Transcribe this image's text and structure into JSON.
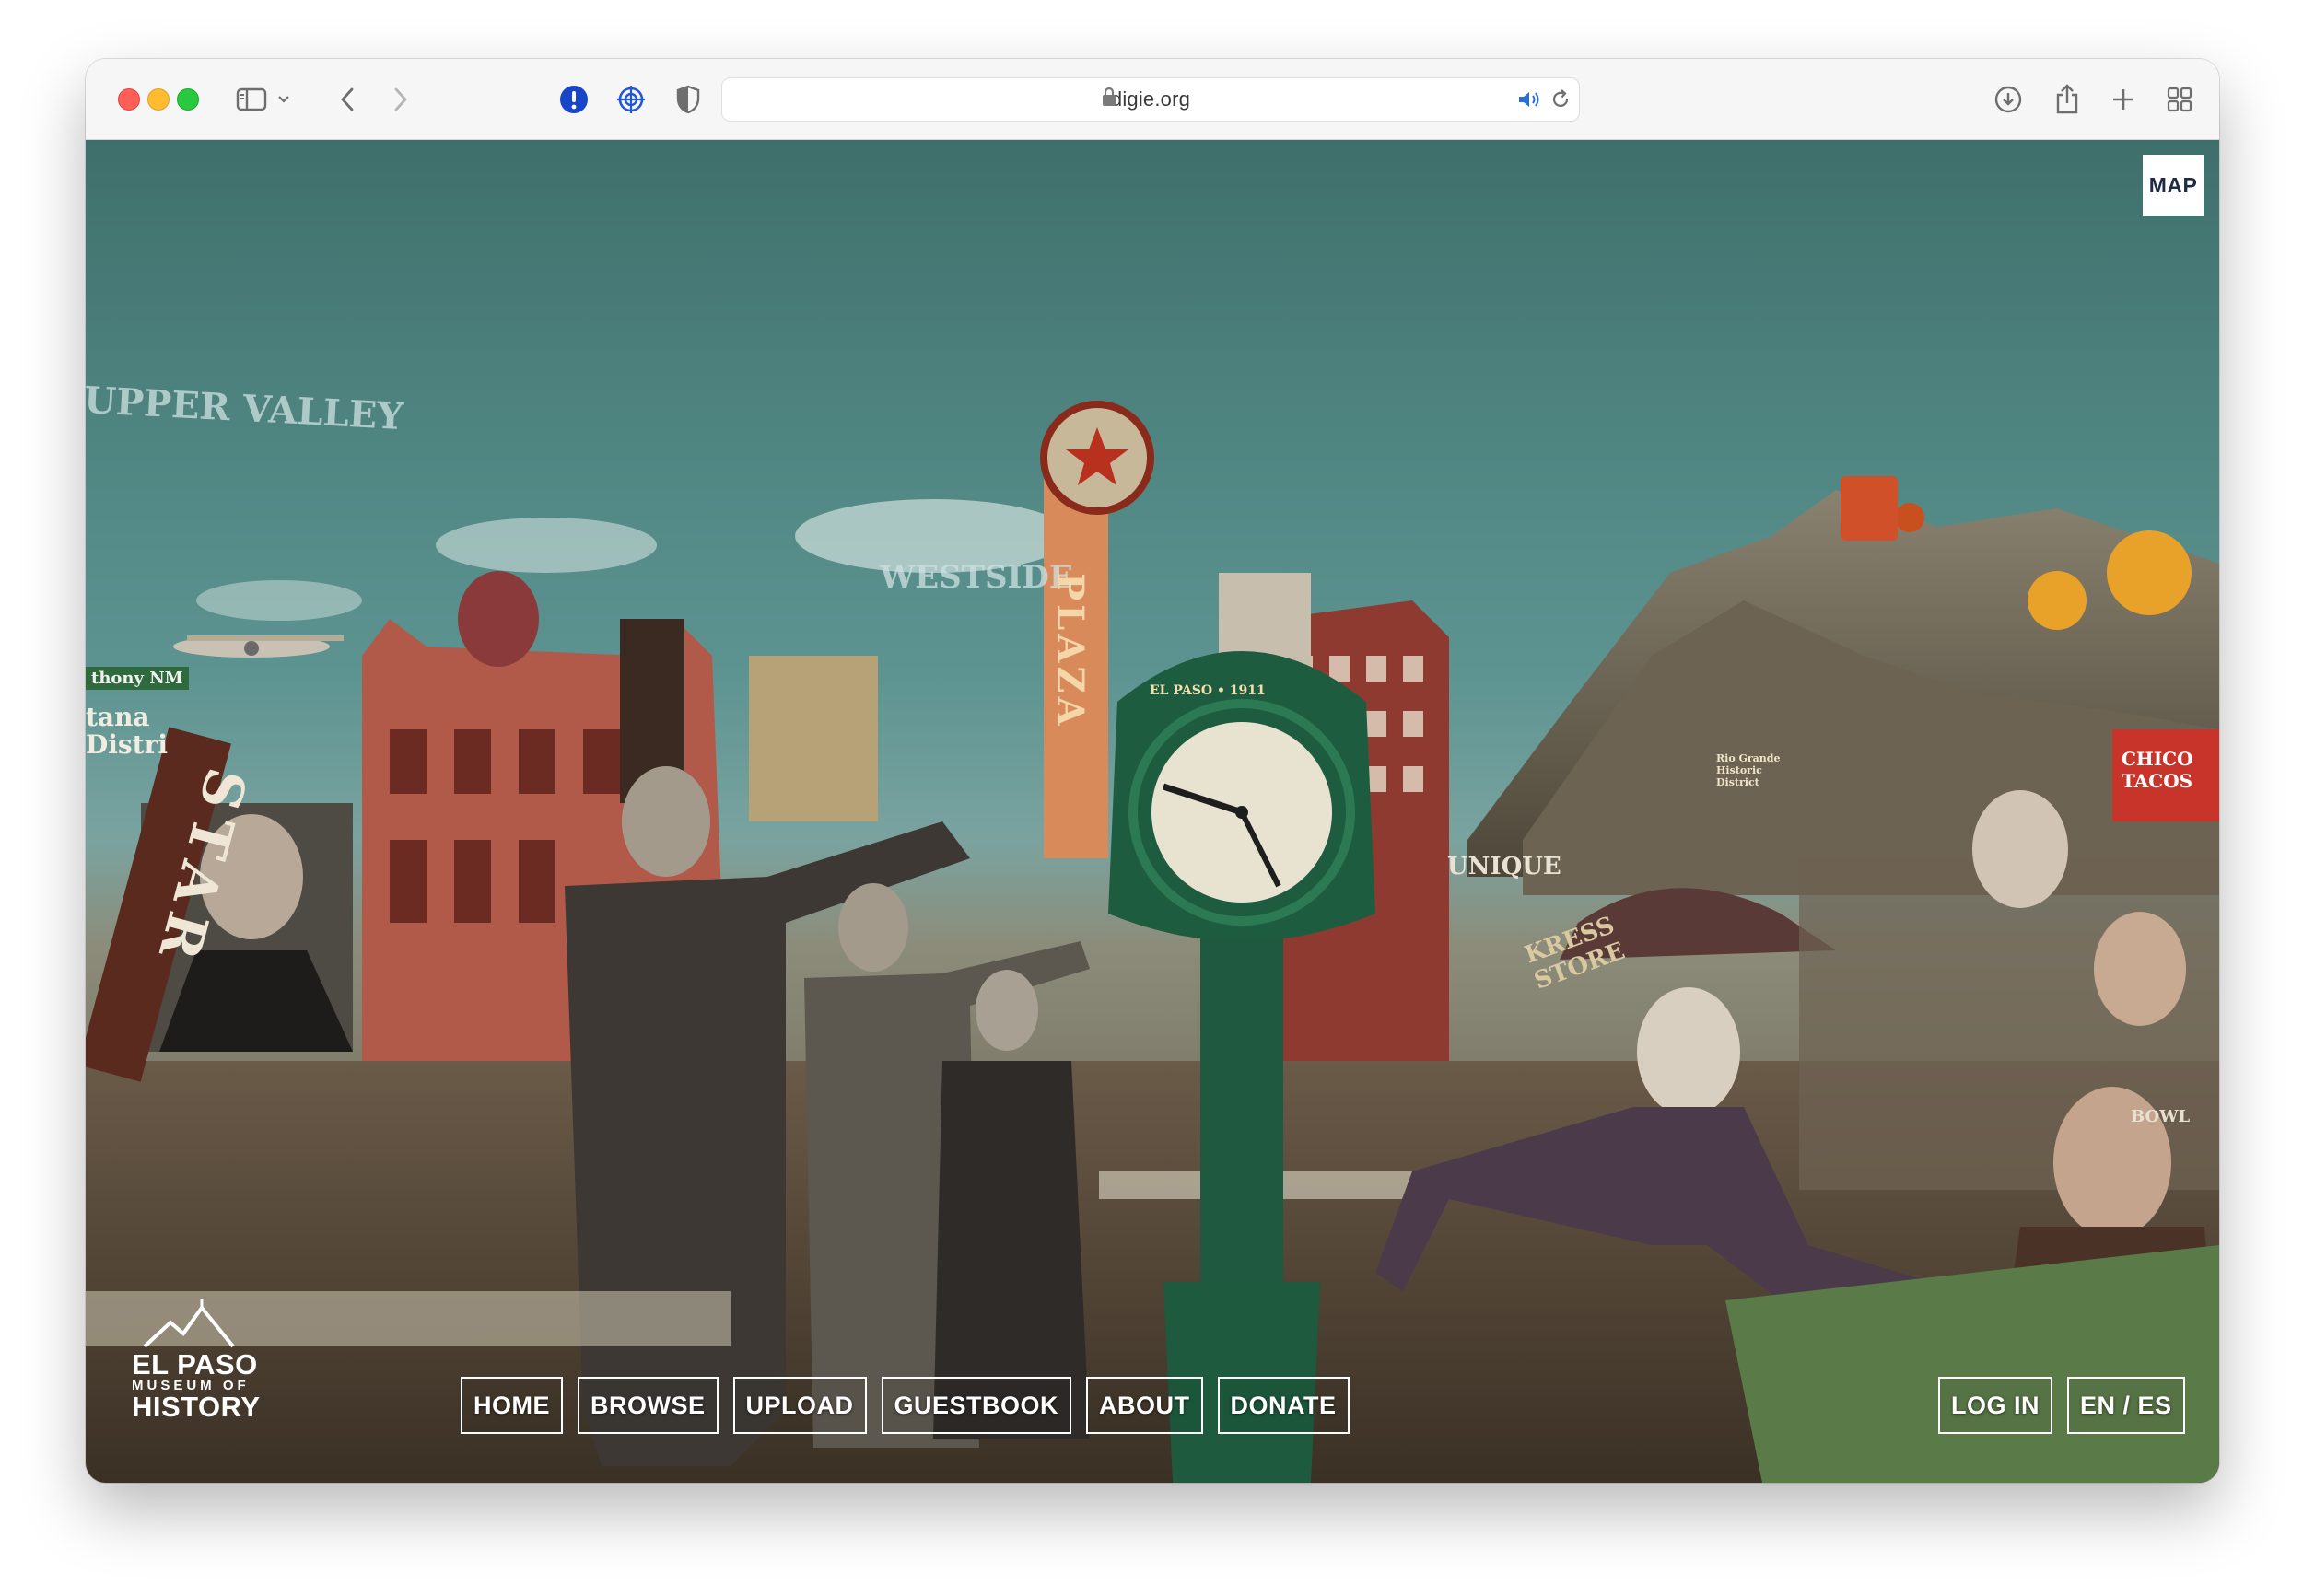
{
  "browser": {
    "url": "digie.org"
  },
  "site": {
    "map_label": "MAP",
    "logo": {
      "line1": "EL PASO",
      "line2": "MUSEUM OF",
      "line3": "HISTORY"
    },
    "nav": {
      "home": "HOME",
      "browse": "BROWSE",
      "upload": "UPLOAD",
      "guestbook": "GUESTBOOK",
      "about": "ABOUT",
      "donate": "DONATE"
    },
    "login": "LOG IN",
    "language": "EN / ES"
  },
  "collage": {
    "upper_valley": "UPPER VALLEY",
    "westside": "WESTSIDE",
    "star_sign": "STAR",
    "plaza_sign": "PLAZA",
    "kress_sign": "KRESS STORE",
    "clock_label": "EL PASO • 1911",
    "unique_sign": "UNIQUE",
    "chico_tacos": "CHICO TACOS",
    "bowl_sign": "BOWL",
    "rio_grande_sign": "Rio Grande Historic District",
    "anthony_sign": "thony NM",
    "santana_sign": "tana Distri"
  }
}
